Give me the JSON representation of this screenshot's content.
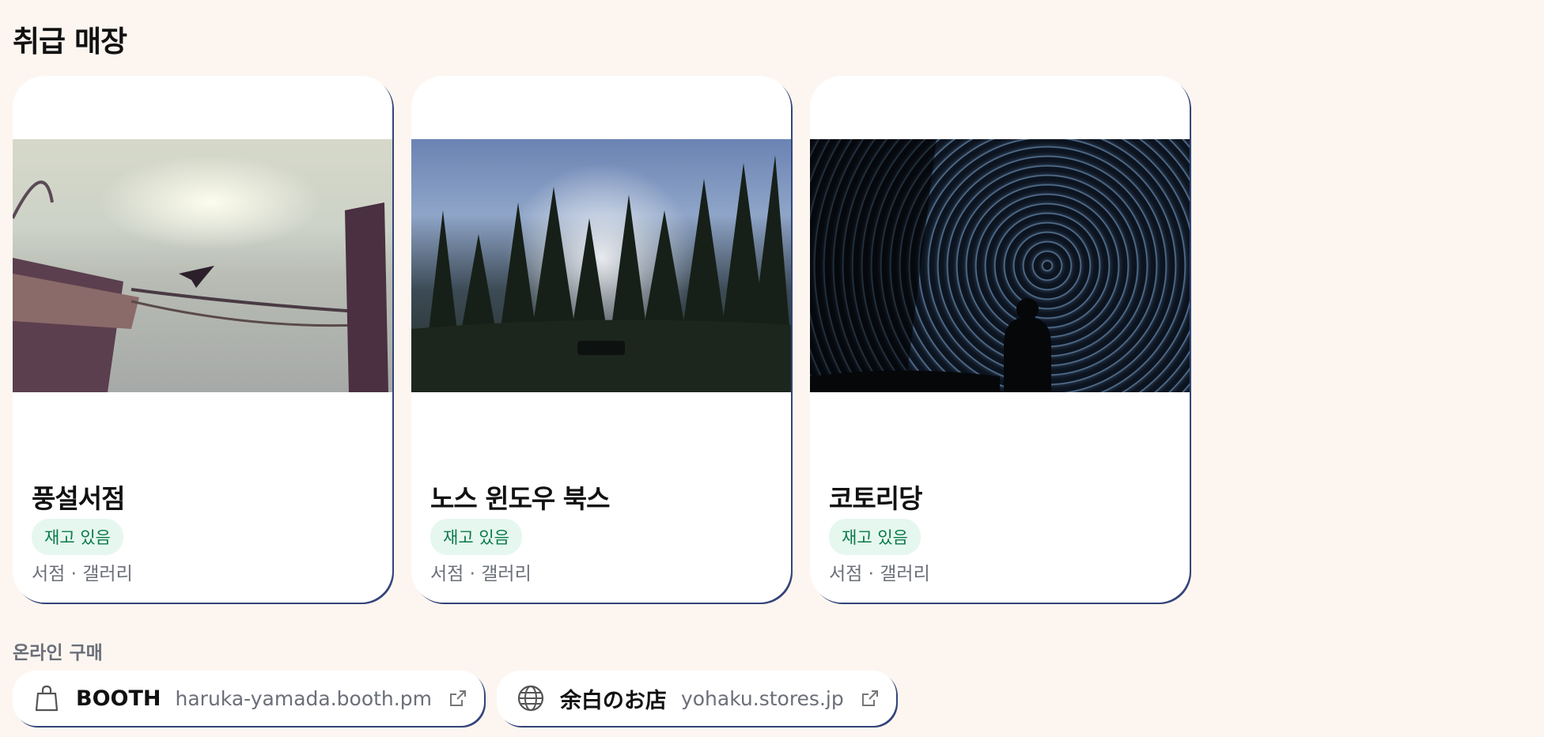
{
  "section": {
    "title": "취급 매장"
  },
  "stores": [
    {
      "name": "풍설서점",
      "badge": "재고 있음",
      "category": "서점 · 갤러리",
      "image": "harbor-cormorant-photo"
    },
    {
      "name": "노스 윈도우 북스",
      "badge": "재고 있음",
      "category": "서점 · 갤러리",
      "image": "forest-sunbeams-photo"
    },
    {
      "name": "코토리당",
      "badge": "재고 있음",
      "category": "서점 · 갤러리",
      "image": "star-trails-photo"
    }
  ],
  "online": {
    "label": "온라인 구매",
    "links": [
      {
        "name": "BOOTH",
        "url": "haruka-yamada.booth.pm",
        "icon": "shopping-bag-icon"
      },
      {
        "name": "余白のお店",
        "url": "yohaku.stores.jp",
        "icon": "globe-icon"
      }
    ]
  },
  "colors": {
    "background": "#fdf6f0",
    "badge_bg": "#e6f7ef",
    "badge_text": "#0a7a4a",
    "border_accent": "#34447a"
  }
}
